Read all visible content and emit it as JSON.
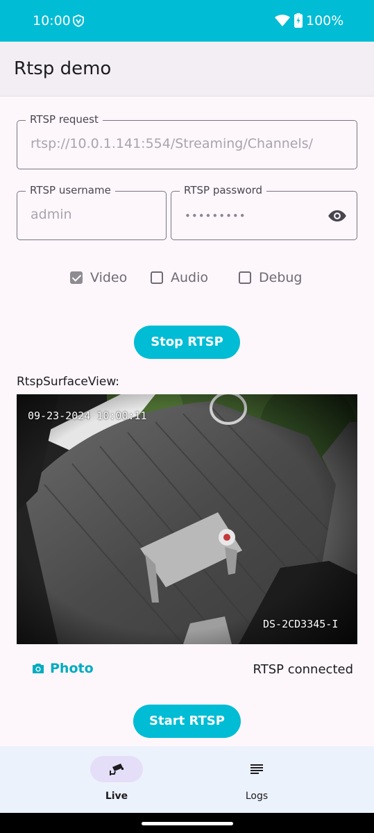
{
  "status_bar": {
    "time": "10:00",
    "battery": "100%",
    "icons": [
      "shield-icon",
      "wifi-icon",
      "battery-charging-icon"
    ]
  },
  "app_bar": {
    "title": "Rtsp demo"
  },
  "form": {
    "request": {
      "label": "RTSP request",
      "value": "rtsp://10.0.1.141:554/Streaming/Channels/"
    },
    "username": {
      "label": "RTSP username",
      "value": "admin"
    },
    "password": {
      "label": "RTSP password",
      "value": "•••••••••"
    },
    "checkboxes": [
      {
        "label": "Video",
        "checked": true
      },
      {
        "label": "Audio",
        "checked": false
      },
      {
        "label": "Debug",
        "checked": false
      }
    ]
  },
  "buttons": {
    "stop": "Stop RTSP",
    "start": "Start RTSP",
    "photo": "Photo"
  },
  "surface": {
    "label": "RtspSurfaceView:",
    "timestamp": "09-23-2024 10:00:11",
    "camera_model": "DS-2CD3345-I"
  },
  "rtsp_status": "RTSP connected",
  "bottom_nav": {
    "items": [
      {
        "label": "Live",
        "icon": "cctv-camera-icon",
        "active": true
      },
      {
        "label": "Logs",
        "icon": "list-lines-icon",
        "active": false
      }
    ]
  },
  "colors": {
    "accent": "#00bcd4",
    "background": "#fdf7fc",
    "nav_background": "#ecf2fb",
    "active_pill": "#e5def8"
  }
}
